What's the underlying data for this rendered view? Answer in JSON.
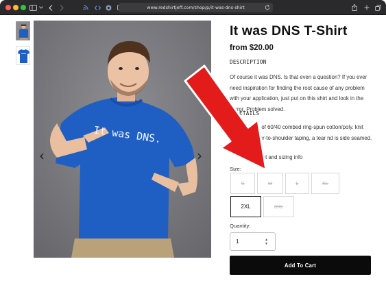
{
  "browser": {
    "url": "www.redshirtjeff.com/shop/p/it-was-dns-shirt",
    "icons": [
      "sidebar-icon",
      "back-icon",
      "forward-icon",
      "rss-icon",
      "code-icon",
      "extension-icon",
      "reader-icon",
      "reload-icon",
      "share-icon",
      "new-tab-icon",
      "tabs-icon"
    ]
  },
  "gallery": {
    "thumbnails": [
      "model-wearing-shirt",
      "shirt-flat"
    ],
    "shirt_print": "It was DNS."
  },
  "product": {
    "title": "It was DNS T-Shirt",
    "price": "from $20.00",
    "description_heading": "DESCRIPTION",
    "description": "Of course it was DNS. Is that even a question? If you ever need inspiration for finding the root cause of any problem with your application, just put on this shirt and look in the mirror. Problem solved.",
    "details_heading": "ETAILS",
    "details": "shirt is made of 60/40 combed ring-spun cotton/poly. knit neck, shoulder-to-shoulder taping, a tear nd is side seamed.",
    "sizing_link": "ment and sizing info"
  },
  "sizes": {
    "label": "Size:",
    "options": [
      {
        "label": "S",
        "available": false
      },
      {
        "label": "M",
        "available": false
      },
      {
        "label": "L",
        "available": false
      },
      {
        "label": "XL",
        "available": false
      },
      {
        "label": "2XL",
        "available": true,
        "selected": true
      },
      {
        "label": "3XL",
        "available": false
      }
    ]
  },
  "quantity": {
    "label": "Quantity:",
    "value": "1"
  },
  "cart": {
    "add_label": "Add To Cart"
  },
  "colors": {
    "shirt_blue": "#1f5fc4",
    "arrow_red": "#e31b1b",
    "button_black": "#0b0b0b"
  }
}
